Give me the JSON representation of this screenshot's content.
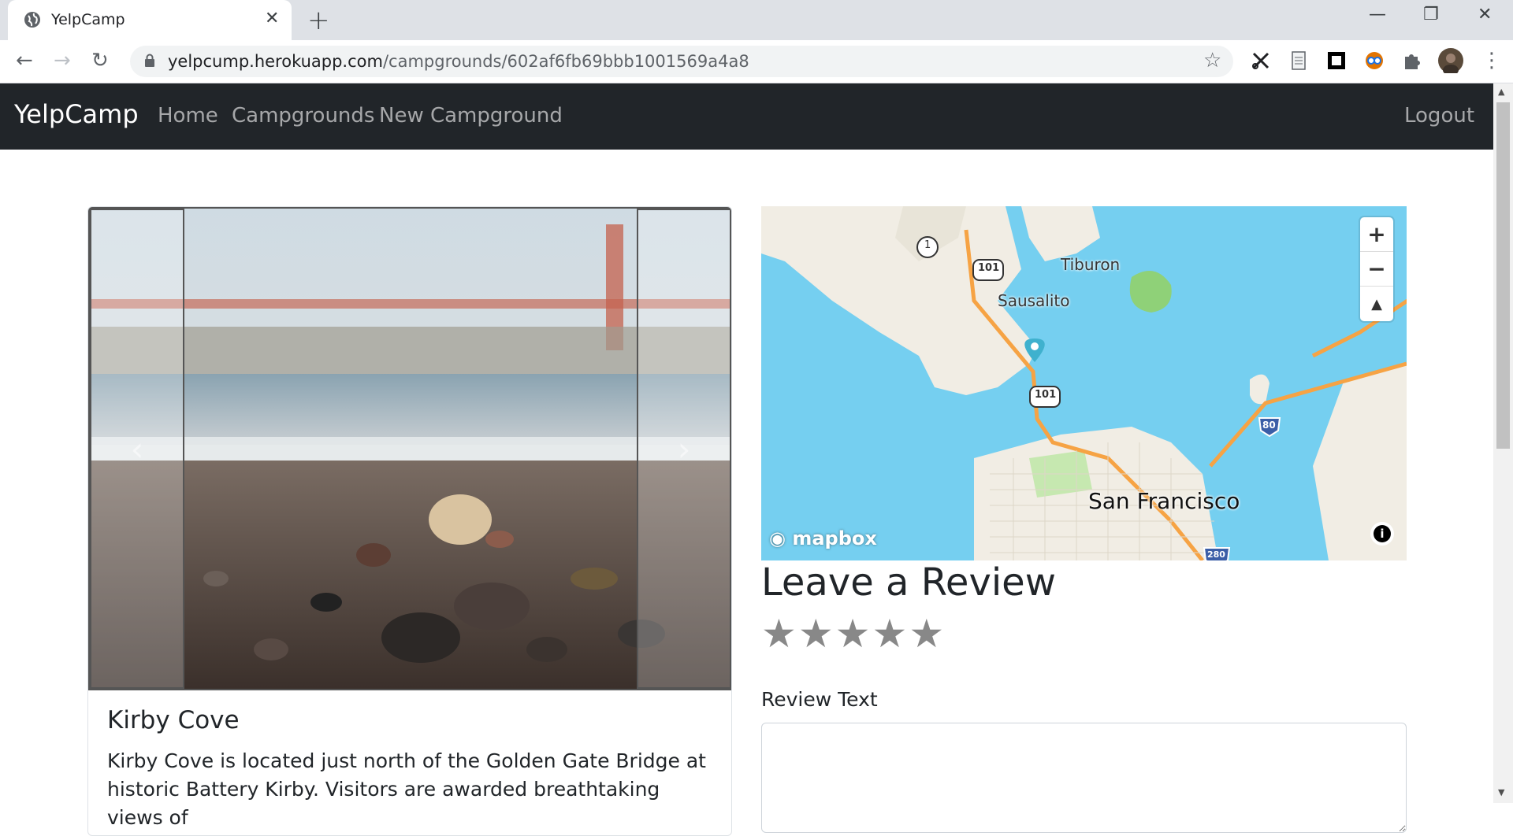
{
  "browser": {
    "tab_title": "YelpCamp",
    "url_host": "yelpcump.herokuapp.com",
    "url_path": "/campgrounds/602af6fb69bbb1001569a4a8"
  },
  "navbar": {
    "brand": "YelpCamp",
    "links": [
      "Home",
      "Campgrounds",
      "New Campground"
    ],
    "logout": "Logout"
  },
  "campground": {
    "title": "Kirby Cove",
    "description": "Kirby Cove is located just north of the Golden Gate Bridge at historic Battery Kirby. Visitors are awarded breathtaking views of"
  },
  "map": {
    "labels": {
      "tiburon": "Tiburon",
      "sausalito": "Sausalito",
      "sf": "San Francisco",
      "r1": "1",
      "r101a": "101",
      "r101b": "101",
      "i80": "80",
      "i280": "280"
    },
    "attribution": "mapbox",
    "controls": {
      "zoom_in": "+",
      "zoom_out": "−",
      "compass": "▲"
    }
  },
  "review": {
    "heading": "Leave a Review",
    "rating_max": 5,
    "stars": [
      "★",
      "★",
      "★",
      "★",
      "★"
    ],
    "text_label": "Review Text",
    "text_value": ""
  },
  "colors": {
    "navbar_bg": "#212529",
    "water": "#75cff0",
    "land": "#f1ede4",
    "marker": "#3fb1ce"
  }
}
